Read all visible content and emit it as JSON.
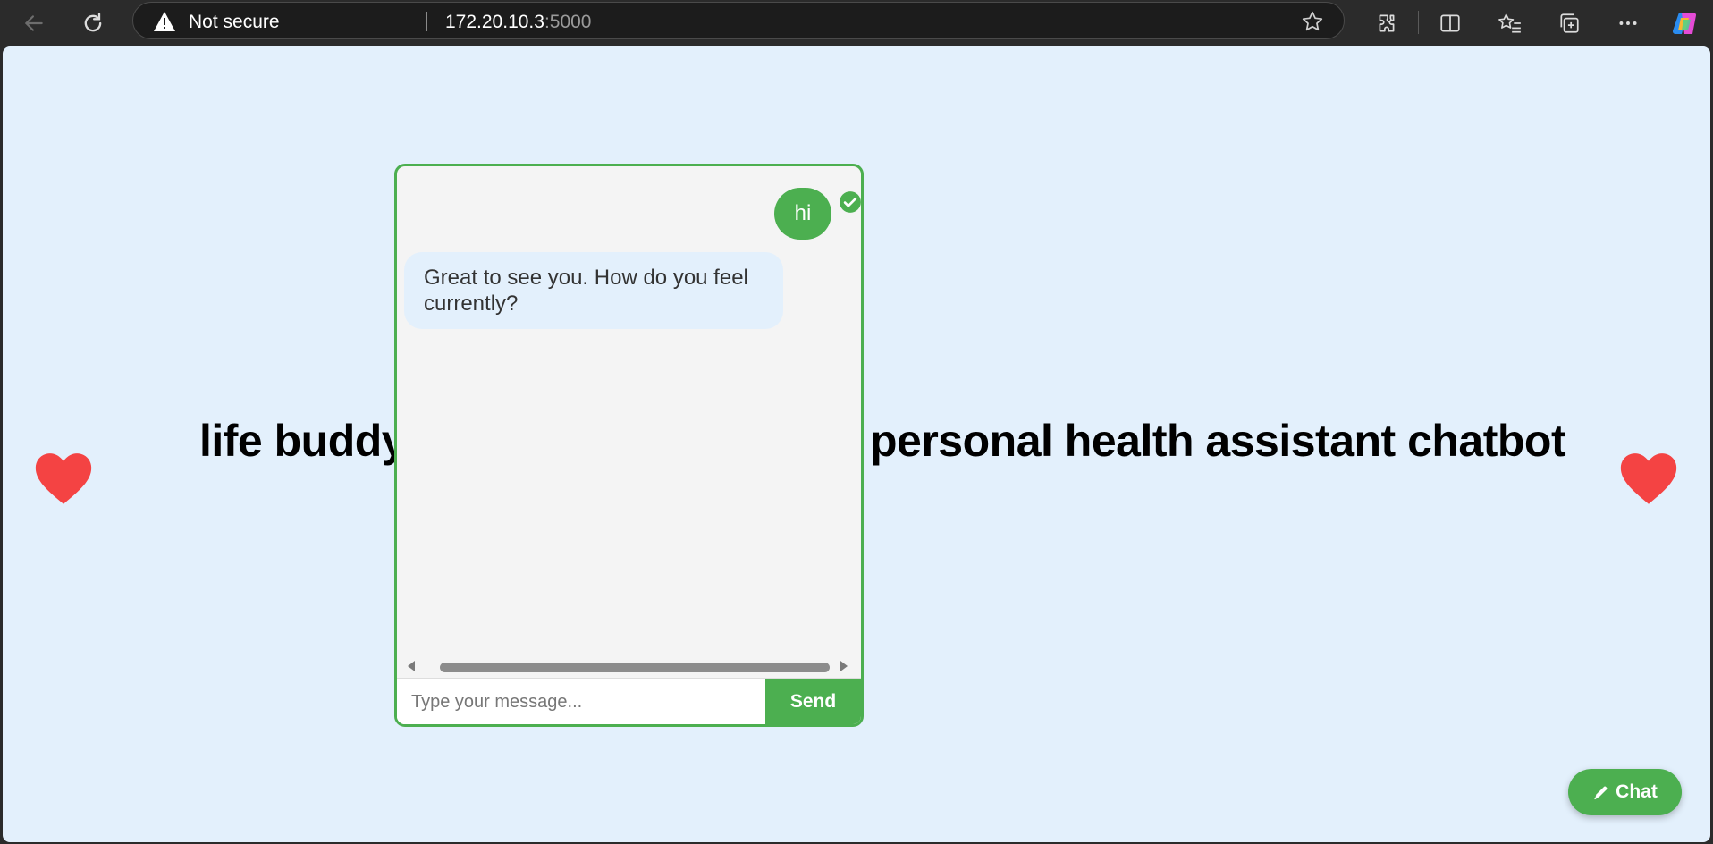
{
  "browser": {
    "security_label": "Not secure",
    "url_host": "172.20.10.3",
    "url_port": ":5000"
  },
  "page": {
    "title_left": "life buddy",
    "title_right": "personal health assistant chatbot"
  },
  "chat": {
    "messages": [
      {
        "sender": "user",
        "text": "hi",
        "status": "delivered"
      },
      {
        "sender": "bot",
        "text": "Great to see you. How do you feel currently?"
      }
    ],
    "input_placeholder": "Type your message...",
    "send_label": "Send"
  },
  "fab": {
    "label": "Chat"
  },
  "colors": {
    "accent": "#4caf50",
    "page_bg": "#e3f0fc",
    "heart": "#f44343"
  }
}
